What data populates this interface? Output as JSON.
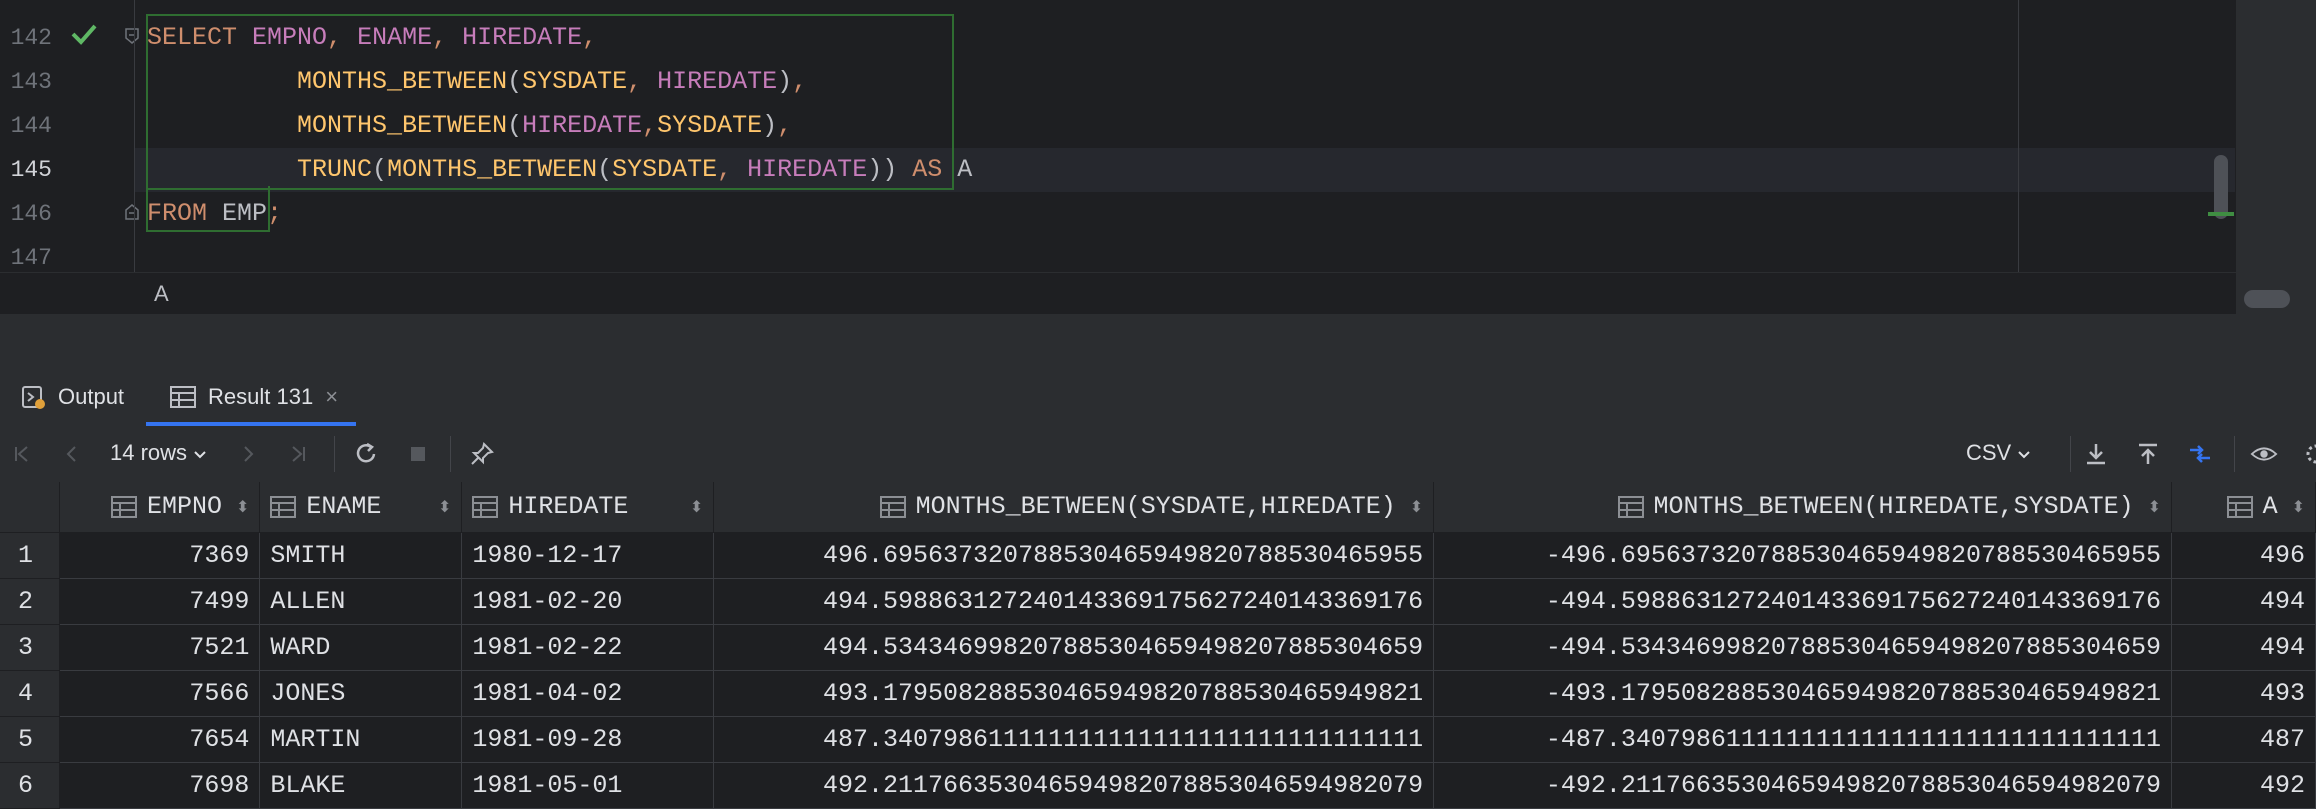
{
  "editor": {
    "line_numbers": [
      "142",
      "143",
      "144",
      "145",
      "146",
      "147"
    ],
    "lines": [
      [
        [
          "kw",
          "SELECT "
        ],
        [
          "id",
          "EMPNO"
        ],
        [
          "op",
          ", "
        ],
        [
          "id",
          "ENAME"
        ],
        [
          "op",
          ", "
        ],
        [
          "id",
          "HIREDATE"
        ],
        [
          "op",
          ","
        ]
      ],
      [
        [
          "pl",
          "          "
        ],
        [
          "fn",
          "MONTHS_BETWEEN"
        ],
        [
          "pl",
          "("
        ],
        [
          "fn",
          "SYSDATE"
        ],
        [
          "op",
          ", "
        ],
        [
          "id",
          "HIREDATE"
        ],
        [
          "pl",
          ")"
        ],
        [
          "op",
          ","
        ]
      ],
      [
        [
          "pl",
          "          "
        ],
        [
          "fn",
          "MONTHS_BETWEEN"
        ],
        [
          "pl",
          "("
        ],
        [
          "id",
          "HIREDATE"
        ],
        [
          "op",
          ","
        ],
        [
          "fn",
          "SYSDATE"
        ],
        [
          "pl",
          ")"
        ],
        [
          "op",
          ","
        ]
      ],
      [
        [
          "pl",
          "          "
        ],
        [
          "fn",
          "TRUNC"
        ],
        [
          "pl",
          "("
        ],
        [
          "fn",
          "MONTHS_BETWEEN"
        ],
        [
          "pl",
          "("
        ],
        [
          "fn",
          "SYSDATE"
        ],
        [
          "op",
          ", "
        ],
        [
          "id",
          "HIREDATE"
        ],
        [
          "pl",
          "))"
        ],
        [
          "kw",
          " AS "
        ],
        [
          "pl",
          "A"
        ]
      ],
      [
        [
          "kw",
          "FROM "
        ],
        [
          "pl",
          "EMP"
        ],
        [
          "op",
          ";"
        ]
      ]
    ],
    "breadcrumb": "A"
  },
  "tool_window": {
    "tabs": [
      {
        "label": "Output"
      },
      {
        "label": "Result 131"
      }
    ],
    "close_glyph": "×"
  },
  "toolbar": {
    "rows_label": "14 rows",
    "format_label": "CSV"
  },
  "grid": {
    "columns": [
      "EMPNO",
      "ENAME",
      "HIREDATE",
      "MONTHS_BETWEEN(SYSDATE,HIREDATE)",
      "MONTHS_BETWEEN(HIREDATE,SYSDATE)",
      "A"
    ],
    "rows": [
      [
        "1",
        "7369",
        "SMITH",
        "1980-12-17",
        "496.695637320788530465949820788530465955",
        "-496.695637320788530465949820788530465955",
        "496"
      ],
      [
        "2",
        "7499",
        "ALLEN",
        "1981-02-20",
        "494.598863127240143369175627240143369176",
        "-494.598863127240143369175627240143369176",
        "494"
      ],
      [
        "3",
        "7521",
        "WARD",
        "1981-02-22",
        "494.534346998207885304659498207885304659",
        "-494.534346998207885304659498207885304659",
        "494"
      ],
      [
        "4",
        "7566",
        "JONES",
        "1981-04-02",
        "493.179508288530465949820788530465949821",
        "-493.179508288530465949820788530465949821",
        "493"
      ],
      [
        "5",
        "7654",
        "MARTIN",
        "1981-09-28",
        "487.340798611111111111111111111111111111",
        "-487.340798611111111111111111111111111111",
        "487"
      ],
      [
        "6",
        "7698",
        "BLAKE",
        "1981-05-01",
        "492.211766353046594982078853046594982079",
        "-492.211766353046594982078853046594982079",
        "492"
      ]
    ]
  },
  "colors": {
    "keyword": "#cf8e6d",
    "identifier": "#c77dbb",
    "function": "#ffc66d",
    "selection_border": "#2f6d31",
    "accent": "#3574f0"
  }
}
